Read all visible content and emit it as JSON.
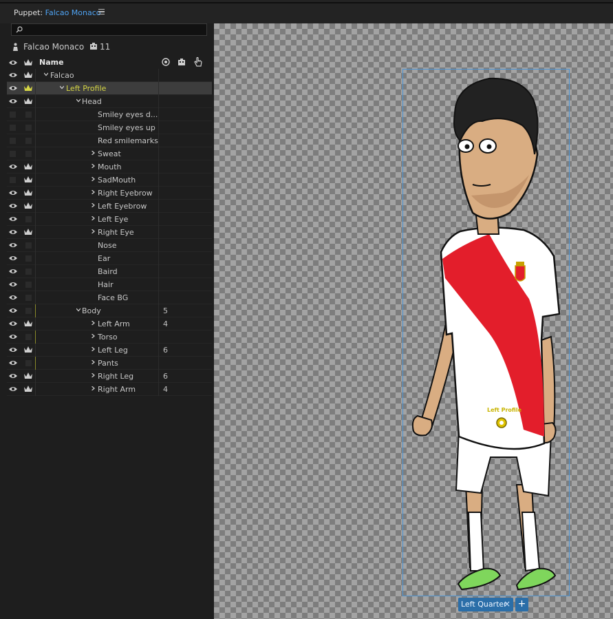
{
  "header": {
    "prefix": "Puppet: ",
    "puppet_name": "Falcao Monaco"
  },
  "search": {
    "placeholder": ""
  },
  "puppet": {
    "name": "Falcao Monaco",
    "count": "11"
  },
  "columns": {
    "name": "Name"
  },
  "rows": [
    {
      "label": "Falcao",
      "indent": 0,
      "chevron": "down",
      "eye": true,
      "crown": true,
      "crown_color": "#cfcfcf",
      "count": ""
    },
    {
      "label": "Left Profile",
      "indent": 1,
      "chevron": "down",
      "eye": true,
      "crown": true,
      "crown_color": "#d6d645",
      "count": "",
      "selected": true,
      "highlight": true
    },
    {
      "label": "Head",
      "indent": 2,
      "chevron": "down",
      "eye": true,
      "crown": true,
      "crown_color": "#cfcfcf",
      "count": ""
    },
    {
      "label": "Smiley eyes d...",
      "indent": 3,
      "chevron": "none",
      "eye": false,
      "crown": false,
      "count": ""
    },
    {
      "label": "Smiley eyes up",
      "indent": 3,
      "chevron": "none",
      "eye": false,
      "crown": false,
      "count": ""
    },
    {
      "label": "Red smilemarks",
      "indent": 3,
      "chevron": "none",
      "eye": false,
      "crown": false,
      "count": ""
    },
    {
      "label": "Sweat",
      "indent": 3,
      "chevron": "right",
      "eye": false,
      "crown": false,
      "count": ""
    },
    {
      "label": "Mouth",
      "indent": 3,
      "chevron": "right",
      "eye": true,
      "crown": true,
      "crown_color": "#cfcfcf",
      "count": ""
    },
    {
      "label": "SadMouth",
      "indent": 3,
      "chevron": "right",
      "eye": false,
      "crown": true,
      "crown_color": "#cfcfcf",
      "count": ""
    },
    {
      "label": "Right Eyebrow",
      "indent": 3,
      "chevron": "right",
      "eye": true,
      "crown": true,
      "crown_color": "#cfcfcf",
      "count": ""
    },
    {
      "label": "Left Eyebrow",
      "indent": 3,
      "chevron": "right",
      "eye": true,
      "crown": true,
      "crown_color": "#cfcfcf",
      "count": ""
    },
    {
      "label": "Left Eye",
      "indent": 3,
      "chevron": "right",
      "eye": true,
      "crown": false,
      "count": ""
    },
    {
      "label": "Right Eye",
      "indent": 3,
      "chevron": "right",
      "eye": true,
      "crown": true,
      "crown_color": "#cfcfcf",
      "count": ""
    },
    {
      "label": "Nose",
      "indent": 3,
      "chevron": "none",
      "eye": true,
      "crown": false,
      "count": ""
    },
    {
      "label": "Ear",
      "indent": 3,
      "chevron": "none",
      "eye": true,
      "crown": false,
      "count": ""
    },
    {
      "label": "Baird",
      "indent": 3,
      "chevron": "none",
      "eye": true,
      "crown": false,
      "count": ""
    },
    {
      "label": "Hair",
      "indent": 3,
      "chevron": "none",
      "eye": true,
      "crown": false,
      "count": ""
    },
    {
      "label": "Face BG",
      "indent": 3,
      "chevron": "none",
      "eye": true,
      "crown": false,
      "count": ""
    },
    {
      "label": "Body",
      "indent": 2,
      "chevron": "down",
      "eye": true,
      "crown": false,
      "count": "5",
      "yline": true
    },
    {
      "label": "Left Arm",
      "indent": 3,
      "chevron": "right",
      "eye": true,
      "crown": true,
      "crown_color": "#cfcfcf",
      "count": "4"
    },
    {
      "label": "Torso",
      "indent": 3,
      "chevron": "right",
      "eye": true,
      "crown": false,
      "count": "",
      "yline": true
    },
    {
      "label": "Left Leg",
      "indent": 3,
      "chevron": "right",
      "eye": true,
      "crown": true,
      "crown_color": "#cfcfcf",
      "count": "6"
    },
    {
      "label": "Pants",
      "indent": 3,
      "chevron": "right",
      "eye": true,
      "crown": false,
      "count": "",
      "yline": true
    },
    {
      "label": "Right Leg",
      "indent": 3,
      "chevron": "right",
      "eye": true,
      "crown": true,
      "crown_color": "#cfcfcf",
      "count": "6"
    },
    {
      "label": "Right Arm",
      "indent": 3,
      "chevron": "right",
      "eye": true,
      "crown": true,
      "crown_color": "#cfcfcf",
      "count": "4"
    }
  ],
  "canvas": {
    "origin_label": "Left Profile"
  },
  "tag": {
    "label": "Left Quarter",
    "remove": "×",
    "add": "+"
  },
  "colors": {
    "accent": "#4fa3f3",
    "selected_row": "#3d3d3d",
    "highlight": "#d6d645",
    "tag": "#2b6ea8",
    "shirt_red": "#e31e2b"
  }
}
